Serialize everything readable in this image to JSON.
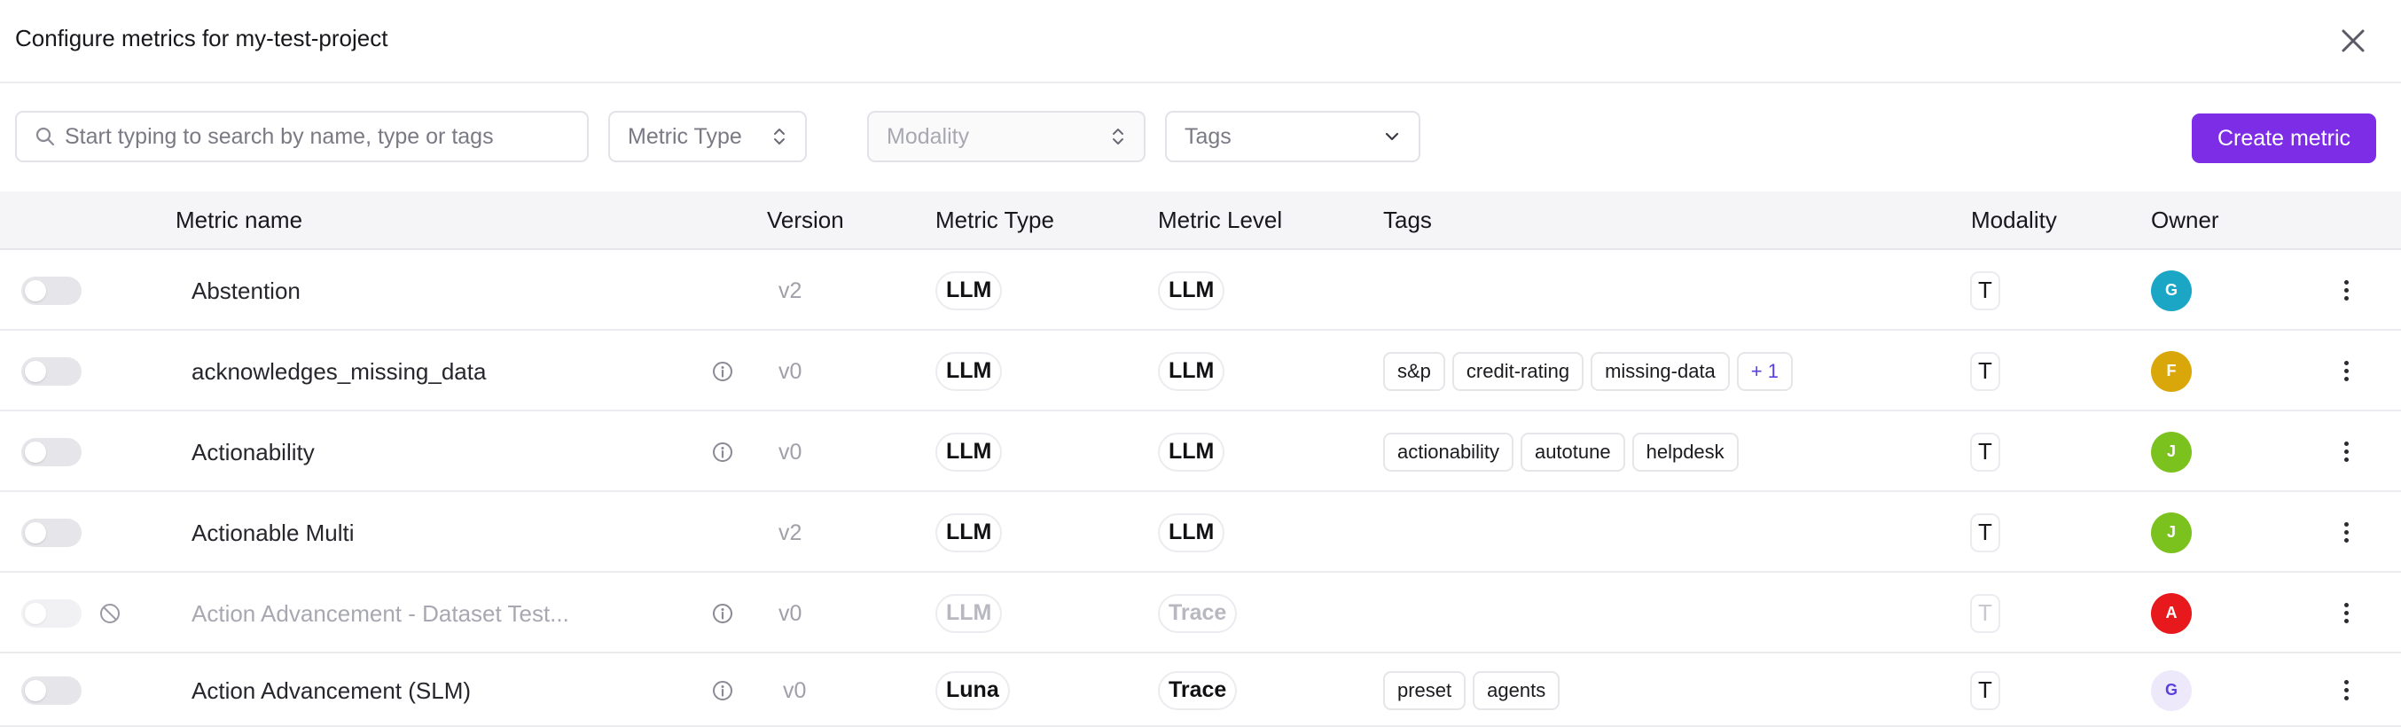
{
  "header": {
    "title": "Configure metrics for my-test-project",
    "close_icon": "close-icon"
  },
  "toolbar": {
    "search_placeholder": "Start typing to search by name, type or tags",
    "metric_type_placeholder": "Metric Type",
    "modality_placeholder": "Modality",
    "tags_placeholder": "Tags",
    "create_label": "Create metric",
    "create_color": "#7e2de6"
  },
  "table": {
    "columns": {
      "name": "Metric name",
      "version": "Version",
      "type": "Metric Type",
      "level": "Metric Level",
      "tags": "Tags",
      "modality": "Modality",
      "owner": "Owner"
    },
    "rows": [
      {
        "name": "Abstention",
        "version": "v2",
        "type": "LLM",
        "level": "LLM",
        "tags": [],
        "modality": "T",
        "owner_initial": "G",
        "owner_color": "#1aa6c4",
        "enabled": false,
        "disabled": false,
        "info": false
      },
      {
        "name": "acknowledges_missing_data",
        "version": "v0",
        "type": "LLM",
        "level": "LLM",
        "tags": [
          "s&p",
          "credit-rating",
          "missing-data"
        ],
        "more_tags": "+ 1",
        "modality": "T",
        "owner_initial": "F",
        "owner_color": "#d9a70a",
        "enabled": false,
        "disabled": false,
        "info": true
      },
      {
        "name": "Actionability",
        "version": "v0",
        "type": "LLM",
        "level": "LLM",
        "tags": [
          "actionability",
          "autotune",
          "helpdesk"
        ],
        "modality": "T",
        "owner_initial": "J",
        "owner_color": "#7cc21f",
        "enabled": false,
        "disabled": false,
        "info": true
      },
      {
        "name": "Actionable Multi",
        "version": "v2",
        "type": "LLM",
        "level": "LLM",
        "tags": [],
        "modality": "T",
        "owner_initial": "J",
        "owner_color": "#7cc21f",
        "enabled": false,
        "disabled": false,
        "info": false
      },
      {
        "name": "Action Advancement - Dataset Test...",
        "version": "v0",
        "type": "LLM",
        "level": "Trace",
        "tags": [],
        "modality": "T",
        "owner_initial": "A",
        "owner_color": "#e8191d",
        "enabled": false,
        "disabled": true,
        "info": true
      },
      {
        "name": "Action Advancement (SLM)",
        "version": "v0",
        "type": "Luna",
        "level": "Trace",
        "tags": [
          "preset",
          "agents"
        ],
        "modality": "T",
        "owner_initial": "G",
        "owner_color": "#ede9fb",
        "owner_text_color": "#5b3fdc",
        "enabled": false,
        "disabled": false,
        "info": true
      }
    ]
  }
}
